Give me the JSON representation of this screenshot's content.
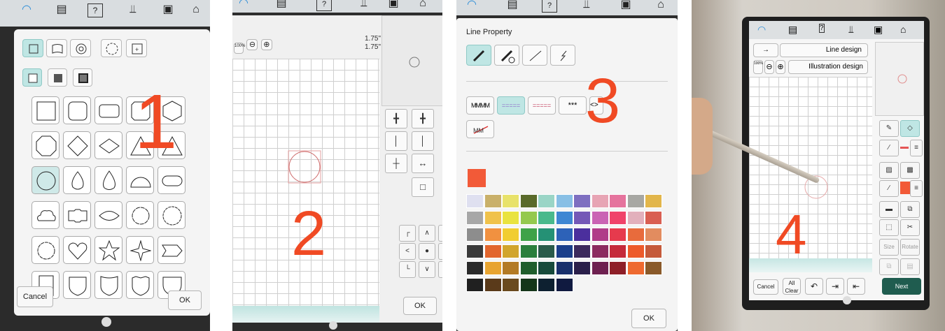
{
  "colors": {
    "accent": "#bfe6e4",
    "number": "#f04a24",
    "topbar": "#d9dde0",
    "next": "#1f5c4f",
    "outline_red": "#e45555"
  },
  "topbar_icons": [
    "wifi-icon",
    "document-icon",
    "help-icon",
    "thread-icon",
    "lock-icon",
    "home-icon"
  ],
  "panel1": {
    "shape_types": [
      "square-shape-icon",
      "wave-square-icon",
      "spiral-icon",
      "flower-frame-icon",
      "image-shape-icon"
    ],
    "fill_modes": [
      "outline-icon",
      "filled-icon",
      "filled-outline-icon"
    ],
    "shapes": [
      "square",
      "rounded-square",
      "rounded-rect",
      "octagon-corner",
      "hexagon",
      "octagon",
      "diamond",
      "wide-diamond",
      "triangle",
      "triangle-right",
      "circle",
      "teardrop",
      "drop",
      "half-circle",
      "pill",
      "cloud",
      "banner",
      "leaf",
      "flower",
      "scalloped",
      "scallop-round",
      "heart",
      "star",
      "four-star",
      "arrow-tag",
      "bookmark",
      "shield",
      "shield-2",
      "shield-3",
      "shield-4"
    ],
    "selected_shape": 10,
    "cancel": "Cancel",
    "ok": "OK",
    "number": "1"
  },
  "panel2": {
    "zoom": "100%",
    "size_w": "1.75\"",
    "size_h": "1.75\"",
    "ok": "OK",
    "number": "2",
    "move_arrows": [
      "⌐",
      "^",
      "¬",
      "<",
      "•",
      ">",
      "L",
      "v",
      "┘"
    ]
  },
  "panel3": {
    "title": "Line Property",
    "number": "3",
    "ok": "OK",
    "line_types": [
      "pen-line-icon",
      "pen-outline-icon",
      "straight-line-icon",
      "zigzag-line-icon"
    ],
    "stitches": [
      "MMMM",
      "=====",
      "=====",
      "***",
      ""
    ],
    "palette": [
      "#dfe0f0",
      "#c9b06a",
      "#e8e26a",
      "#5a6a2a",
      "#9ad5c6",
      "#88bfe5",
      "#7e6fc0",
      "#e7a4b4",
      "#e5739d",
      "#a7a7a3",
      "#e2b64b",
      "#a7a7a7",
      "#f0c24b",
      "#e9e33f",
      "#94c94e",
      "#49b98c",
      "#3f87d3",
      "#7458b7",
      "#ca63b4",
      "#f0436a",
      "#e2b0bc",
      "#d95f52",
      "#8d8d8d",
      "#f19140",
      "#f1cd31",
      "#3fa248",
      "#259175",
      "#2d62b8",
      "#4b2f9d",
      "#b03c89",
      "#e63a4d",
      "#e86b3c",
      "#e28c5f",
      "#3a3a3a",
      "#e2662d",
      "#d1a52c",
      "#2a7f3c",
      "#2a5b4a",
      "#1b3f8b",
      "#3c2a5d",
      "#8c2b60",
      "#c52a3a",
      "#ed5a2a",
      "#c55a3a",
      "#2a2a2a",
      "#e8a430",
      "#b37a24",
      "#1f5e2c",
      "#174a3b",
      "#19306c",
      "#2a1f4a",
      "#6e2050",
      "#8e1f28",
      "#ee6a30",
      "#8a5a2a",
      "#202020",
      "#5a3a1a",
      "#6a4a1e",
      "#15361a",
      "#0d2030",
      "#101a40"
    ],
    "current_color": "#f25a38"
  },
  "panel4": {
    "line_design": "Line design",
    "illustration_design": "Illustration design",
    "zoom": "100%",
    "size": "Size",
    "rotate": "Rotate",
    "cancel": "Cancel",
    "all_clear": "All Clear",
    "next": "Next",
    "number": "4"
  }
}
